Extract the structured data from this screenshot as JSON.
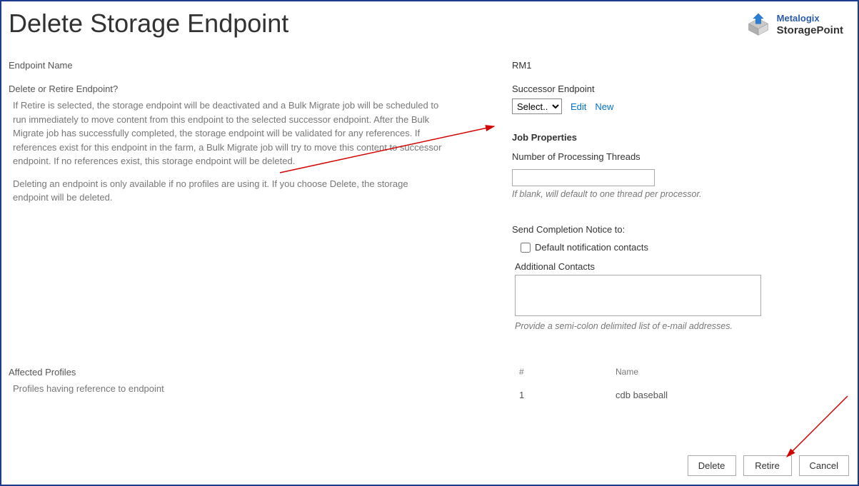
{
  "logo": {
    "brand": "Metalogix",
    "product": "StoragePoint"
  },
  "page_title": "Delete Storage Endpoint",
  "left": {
    "endpoint_name_label": "Endpoint Name",
    "delete_retire_label": "Delete or Retire Endpoint?",
    "desc1": "If Retire is selected, the storage endpoint will be deactivated and a Bulk Migrate job will be scheduled to run immediately to move content from this endpoint to the selected successor endpoint. After the Bulk Migrate job has successfully completed, the storage endpoint will be validated for any references. If references exist for this endpoint in the farm, a Bulk Migrate job will try to move this content to successor endpoint. If no references exist, this storage endpoint will be deleted.",
    "desc2": "Deleting an endpoint is only available if no profiles are using it. If you choose Delete, the storage endpoint will be deleted."
  },
  "right": {
    "endpoint_name_value": "RM1",
    "successor_label": "Successor Endpoint",
    "successor_select_value": "Select...",
    "edit_link": "Edit",
    "new_link": "New",
    "job_props_title": "Job Properties",
    "threads_label": "Number of Processing Threads",
    "threads_value": "",
    "threads_help": "If blank, will default to one thread per processor.",
    "notice_label": "Send Completion Notice to:",
    "default_contacts_label": "Default notification contacts",
    "default_contacts_checked": false,
    "additional_contacts_label": "Additional Contacts",
    "additional_contacts_value": "",
    "additional_contacts_help": "Provide a semi-colon delimited list of e-mail addresses."
  },
  "affected": {
    "label": "Affected Profiles",
    "desc": "Profiles having reference to endpoint",
    "header_num": "#",
    "header_name": "Name",
    "rows": [
      {
        "num": "1",
        "name": "cdb baseball"
      }
    ]
  },
  "buttons": {
    "delete": "Delete",
    "retire": "Retire",
    "cancel": "Cancel"
  }
}
